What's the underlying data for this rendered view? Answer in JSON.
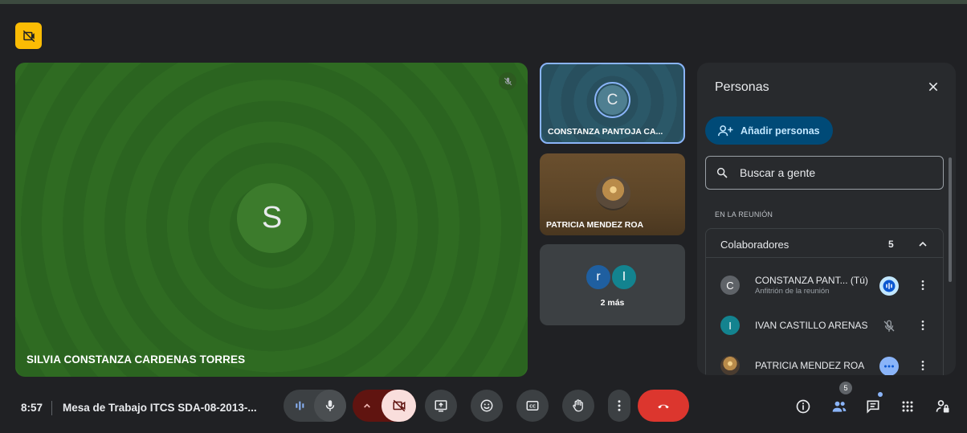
{
  "main_tile": {
    "avatar_letter": "S",
    "name": "SILVIA CONSTANZA CARDENAS TORRES"
  },
  "side_tiles": {
    "speaker": {
      "avatar_letter": "C",
      "name": "CONSTANZA PANTOJA CA..."
    },
    "patricia": {
      "name": "PATRICIA MENDEZ ROA"
    },
    "more": {
      "avatar_1": "r",
      "avatar_2": "I",
      "label": "2 más"
    }
  },
  "panel": {
    "title": "Personas",
    "add_button": "Añadir personas",
    "search_placeholder": "Buscar a gente",
    "section_label": "EN LA REUNIÓN",
    "group_title": "Colaboradores",
    "group_count": "5",
    "participants": [
      {
        "avatar": "C",
        "name": "CONSTANZA PANT...  (Tú)",
        "subtitle": "Anfitrión de la reunión",
        "color": "#5f6368"
      },
      {
        "avatar": "I",
        "name": "IVAN CASTILLO ARENAS",
        "color": "#13838f"
      },
      {
        "name": "PATRICIA MENDEZ ROA"
      }
    ]
  },
  "bottom_bar": {
    "time": "8:57",
    "meeting_title": "Mesa de Trabajo ITCS SDA-08-2013-...",
    "people_count": "5"
  },
  "colors": {
    "end_call": "#dc362e",
    "cam_off_bg": "#f9dedc",
    "accent": "#8ab4f8",
    "rec_badge": "#fbbc04"
  }
}
